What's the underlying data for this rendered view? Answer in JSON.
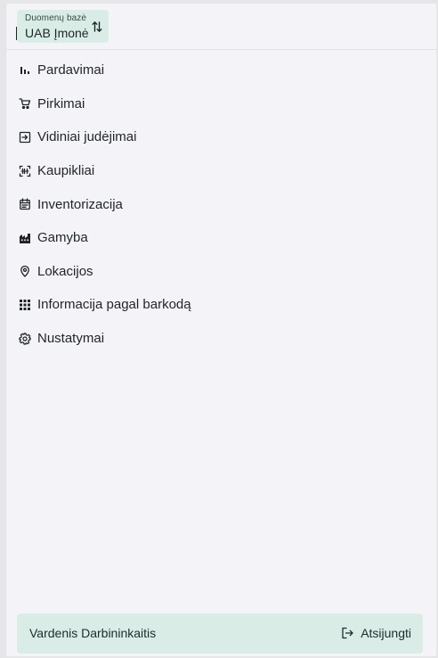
{
  "database": {
    "label": "Duomenų bazė",
    "value": "UAB Įmonė",
    "icon": "swap-vertical-icon"
  },
  "nav": {
    "items": [
      {
        "label": "Pardavimai",
        "icon": "bar-chart-icon"
      },
      {
        "label": "Pirkimai",
        "icon": "shopping-cart-icon"
      },
      {
        "label": "Vidiniai judėjimai",
        "icon": "login-icon"
      },
      {
        "label": "Kaupikliai",
        "icon": "barcode-scanner-icon"
      },
      {
        "label": "Inventorizacija",
        "icon": "calendar-icon"
      },
      {
        "label": "Gamyba",
        "icon": "factory-icon"
      },
      {
        "label": "Lokacijos",
        "icon": "location-pin-icon"
      },
      {
        "label": "Informacija pagal barkodą",
        "icon": "grid-icon"
      },
      {
        "label": "Nustatymai",
        "icon": "gear-icon"
      }
    ]
  },
  "footer": {
    "user_name": "Vardenis Darbininkaitis",
    "logout_label": "Atsijungti",
    "logout_icon": "logout-icon"
  },
  "colors": {
    "accent_bg": "#d9ede6",
    "panel_bg": "#f4f4f8",
    "text": "#1f2428"
  }
}
